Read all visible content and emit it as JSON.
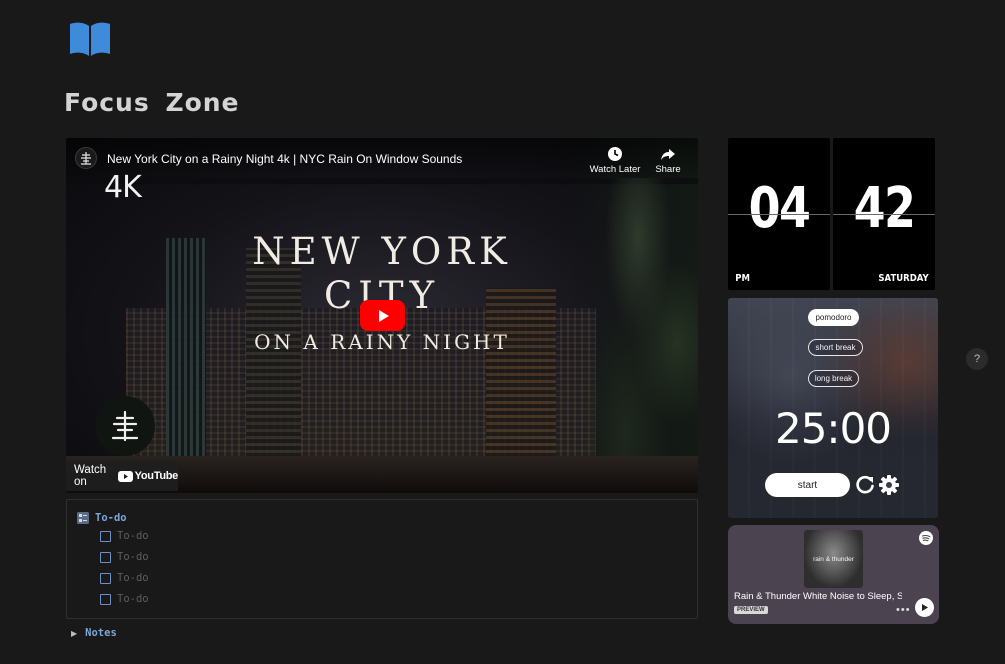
{
  "page": {
    "icon": "open-book-icon",
    "title": "Focus Zone"
  },
  "video": {
    "title": "New York City on a Rainy Night 4k | NYC Rain On Window Sounds",
    "watch_later": "Watch Later",
    "share": "Share",
    "badge": "4K",
    "headline_line1": "NEW YORK",
    "headline_line2": "CITY",
    "headline_line3": "ON A RAINY NIGHT",
    "watch_on": "Watch on",
    "youtube": "YouTube"
  },
  "todo": {
    "heading": "To-do",
    "items": [
      {
        "label": "To-do",
        "checked": false
      },
      {
        "label": "To-do",
        "checked": false
      },
      {
        "label": "To-do",
        "checked": false
      },
      {
        "label": "To-do",
        "checked": false
      }
    ]
  },
  "notes": {
    "label": "Notes"
  },
  "clock": {
    "hour": "04",
    "minute": "42",
    "period": "PM",
    "day": "SATURDAY"
  },
  "pomodoro": {
    "modes": [
      "pomodoro",
      "short break",
      "long break"
    ],
    "active_mode": "pomodoro",
    "timer": "25:00",
    "start_label": "start"
  },
  "spotify": {
    "cover_text": "rain & thunder",
    "track_title": "Rain & Thunder White Noise to Sleep, Study",
    "preview_label": "PREVIEW"
  },
  "help": {
    "label": "?"
  },
  "colors": {
    "background": "#191919",
    "accent_blue": "#7aa6d8",
    "youtube_red": "#ff0000",
    "spotify_bg": "#4b4450"
  }
}
